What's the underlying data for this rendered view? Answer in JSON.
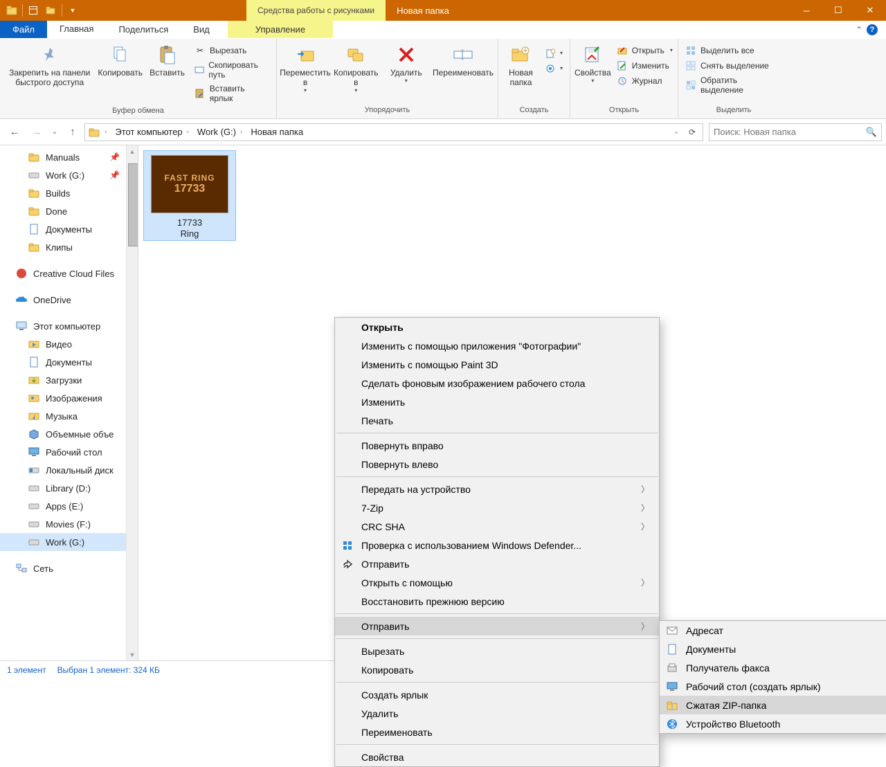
{
  "titlebar": {
    "context_tab": "Средства работы с рисунками",
    "title": "Новая папка"
  },
  "tabs": {
    "file": "Файл",
    "items": [
      "Главная",
      "Поделиться",
      "Вид"
    ],
    "context": "Управление"
  },
  "ribbon": {
    "g0": {
      "pin": "Закрепить на панели быстрого доступа",
      "copy": "Копировать",
      "paste": "Вставить",
      "cut": "Вырезать",
      "copypath": "Скопировать путь",
      "pasteshortcut": "Вставить ярлык",
      "label": "Буфер обмена"
    },
    "g1": {
      "move": "Переместить в",
      "copyto": "Копировать в",
      "delete": "Удалить",
      "rename": "Переименовать",
      "label": "Упорядочить"
    },
    "g2": {
      "newfolder": "Новая папка",
      "label": "Создать"
    },
    "g3": {
      "props": "Свойства",
      "open": "Открыть",
      "edit": "Изменить",
      "history": "Журнал",
      "label": "Открыть"
    },
    "g4": {
      "selall": "Выделить все",
      "selnone": "Снять выделение",
      "selinv": "Обратить выделение",
      "label": "Выделить"
    }
  },
  "breadcrumb": {
    "segs": [
      "Этот компьютер",
      "Work (G:)",
      "Новая папка"
    ]
  },
  "search": {
    "placeholder": "Поиск: Новая папка"
  },
  "tree": {
    "qa": [
      {
        "label": "Manuals",
        "icon": "folder",
        "pin": true
      },
      {
        "label": "Work (G:)",
        "icon": "drive",
        "pin": true
      },
      {
        "label": "Builds",
        "icon": "folder"
      },
      {
        "label": "Done",
        "icon": "folder"
      },
      {
        "label": "Документы",
        "icon": "doc"
      },
      {
        "label": "Клипы",
        "icon": "folder"
      }
    ],
    "cc": "Creative Cloud Files",
    "onedrive": "OneDrive",
    "thispc": "Этот компьютер",
    "pcitems": [
      {
        "label": "Видео",
        "icon": "video"
      },
      {
        "label": "Документы",
        "icon": "doc"
      },
      {
        "label": "Загрузки",
        "icon": "down"
      },
      {
        "label": "Изображения",
        "icon": "img"
      },
      {
        "label": "Музыка",
        "icon": "music"
      },
      {
        "label": "Объемные объе",
        "icon": "cube"
      },
      {
        "label": "Рабочий стол",
        "icon": "desk"
      },
      {
        "label": "Локальный диск",
        "icon": "drive-win"
      },
      {
        "label": "Library (D:)",
        "icon": "drive"
      },
      {
        "label": "Apps (E:)",
        "icon": "drive"
      },
      {
        "label": "Movies (F:)",
        "icon": "drive"
      },
      {
        "label": "Work (G:)",
        "icon": "drive",
        "sel": true
      }
    ],
    "network": "Сеть"
  },
  "file": {
    "thumbtext1": "FAST RING",
    "thumbtext2": "17733",
    "name_l1": "17733",
    "name_l2": "Ring"
  },
  "cmenu": {
    "open": "Открыть",
    "editphotos": "Изменить с помощью приложения \"Фотографии\"",
    "editpaint3d": "Изменить с помощью Paint 3D",
    "setwallpaper": "Сделать фоновым изображением рабочего стола",
    "edit": "Изменить",
    "print": "Печать",
    "rotr": "Повернуть вправо",
    "rotl": "Повернуть влево",
    "cast": "Передать на устройство",
    "zip": "7-Zip",
    "crc": "CRC SHA",
    "defender": "Проверка с использованием Windows Defender...",
    "share": "Отправить",
    "openwith": "Открыть с помощью",
    "restore": "Восстановить прежнюю версию",
    "sendto": "Отправить",
    "cut": "Вырезать",
    "copy": "Копировать",
    "shortcut": "Создать ярлык",
    "delete": "Удалить",
    "rename": "Переименовать",
    "properties": "Свойства"
  },
  "submenu": {
    "mailrec": "Адресат",
    "docs": "Документы",
    "fax": "Получатель факса",
    "desktop": "Рабочий стол (создать ярлык)",
    "zipfolder": "Сжатая ZIP-папка",
    "bluetooth": "Устройство Bluetooth"
  },
  "status": {
    "count": "1 элемент",
    "selection": "Выбран 1 элемент: 324 КБ"
  }
}
